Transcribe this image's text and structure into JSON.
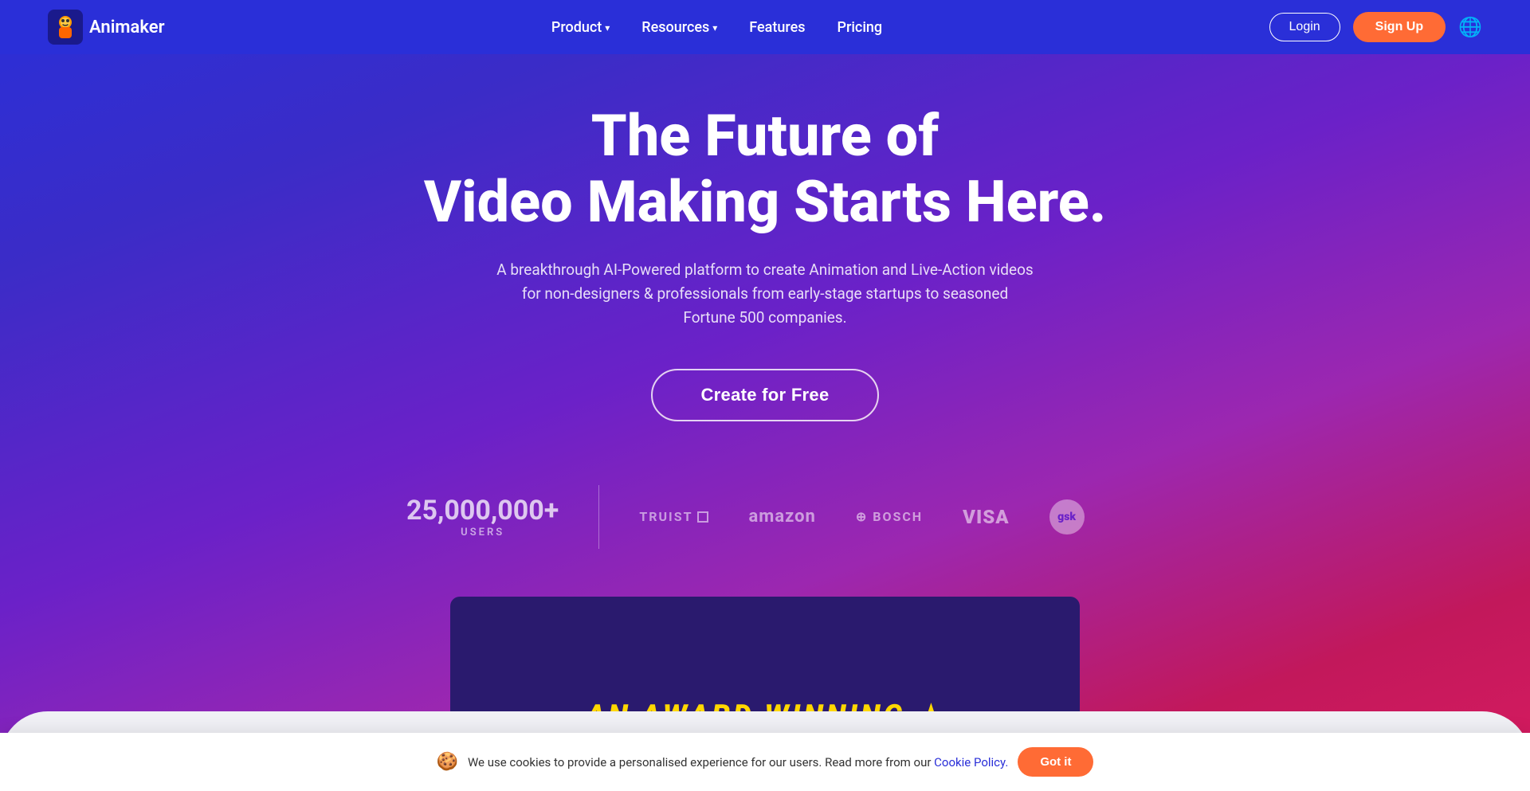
{
  "nav": {
    "logo_text": "Animaker",
    "links": [
      {
        "label": "Product",
        "has_dropdown": true
      },
      {
        "label": "Resources",
        "has_dropdown": true
      },
      {
        "label": "Features",
        "has_dropdown": false
      },
      {
        "label": "Pricing",
        "has_dropdown": false
      }
    ],
    "login_label": "Login",
    "signup_label": "Sign Up"
  },
  "hero": {
    "title_line1": "The Future of",
    "title_line2": "Video Making Starts Here.",
    "subtitle": "A breakthrough AI-Powered platform to create Animation and Live-Action videos for non-designers & professionals from early-stage startups to seasoned Fortune 500 companies.",
    "cta_label": "Create for Free"
  },
  "stats": {
    "number": "25,000,000+",
    "label": "USERS"
  },
  "companies": [
    {
      "name": "TRUIST",
      "class": "truist"
    },
    {
      "name": "amazon",
      "class": "amazon"
    },
    {
      "name": "⊕ BOSCH",
      "class": "bosch"
    },
    {
      "name": "VISA",
      "class": "visa"
    },
    {
      "name": "gsk",
      "class": "gsk"
    }
  ],
  "video_preview": {
    "award_text": "AN AWARD WINNING"
  },
  "cookie": {
    "icon": "🍪",
    "text": "We use cookies to provide a personalised experience for our users. Read more from our",
    "link_text": "Cookie Policy.",
    "button_label": "Got it"
  }
}
